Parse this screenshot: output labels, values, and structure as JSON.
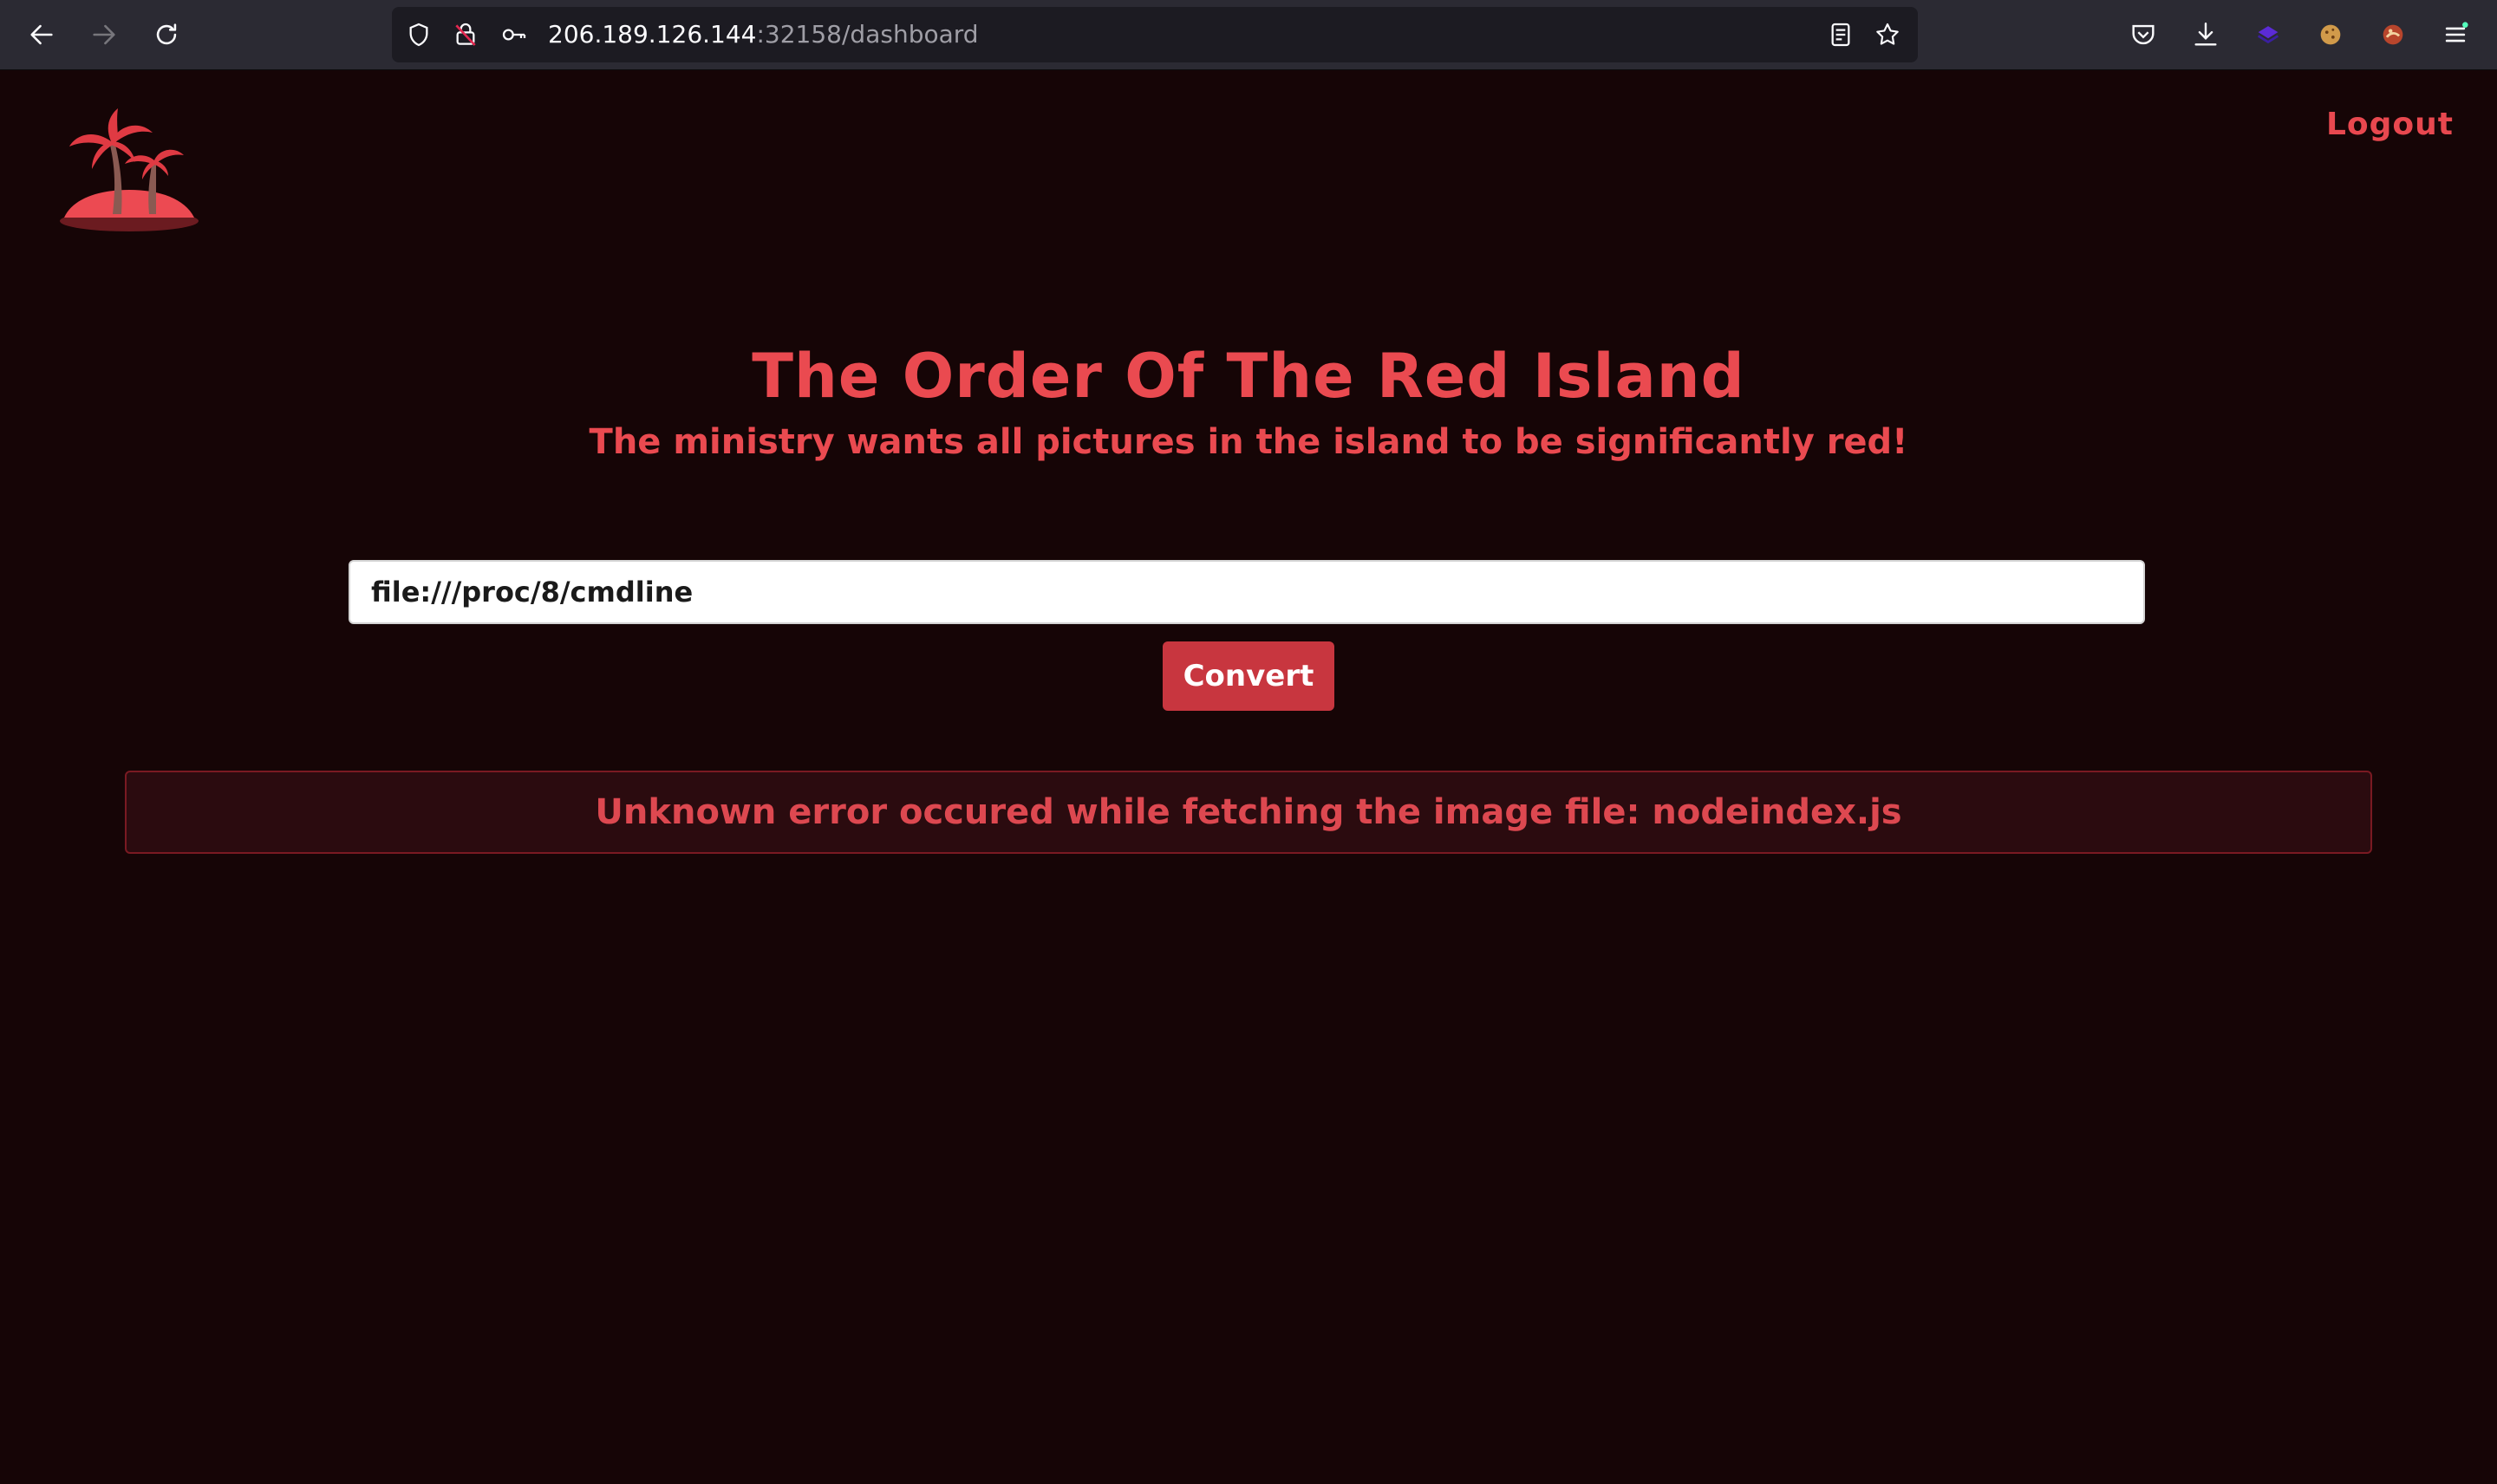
{
  "browser": {
    "url_host": "206.189.126.144",
    "url_path": ":32158/dashboard",
    "icons": {
      "back": "back-arrow-icon",
      "forward": "forward-arrow-icon",
      "reload": "reload-icon",
      "tracking": "shield-icon",
      "insecure": "insecure-lock-icon",
      "key": "key-icon",
      "reader": "reader-view-icon",
      "bookmark": "star-icon",
      "pocket": "pocket-icon",
      "downloads": "download-icon",
      "extension1": "extension-icon",
      "cookie": "cookie-icon",
      "extension2": "extension-icon",
      "menu": "hamburger-menu-icon"
    }
  },
  "header": {
    "logout_label": "Logout",
    "logo_icon": "palm-island-logo"
  },
  "main": {
    "title": "The Order Of The Red Island",
    "subtitle": "The ministry wants all pictures in the island to be significantly red!",
    "url_input_value": "file:///proc/8/cmdline",
    "convert_label": "Convert",
    "error_message": "Unknown error occured while fetching the image file: nodeindex.js"
  },
  "colors": {
    "page_bg": "#160506",
    "accent": "#ea4a50",
    "button_bg": "#c8363f",
    "alert_bg": "#2b0b0f",
    "alert_border": "#7a1a22"
  }
}
